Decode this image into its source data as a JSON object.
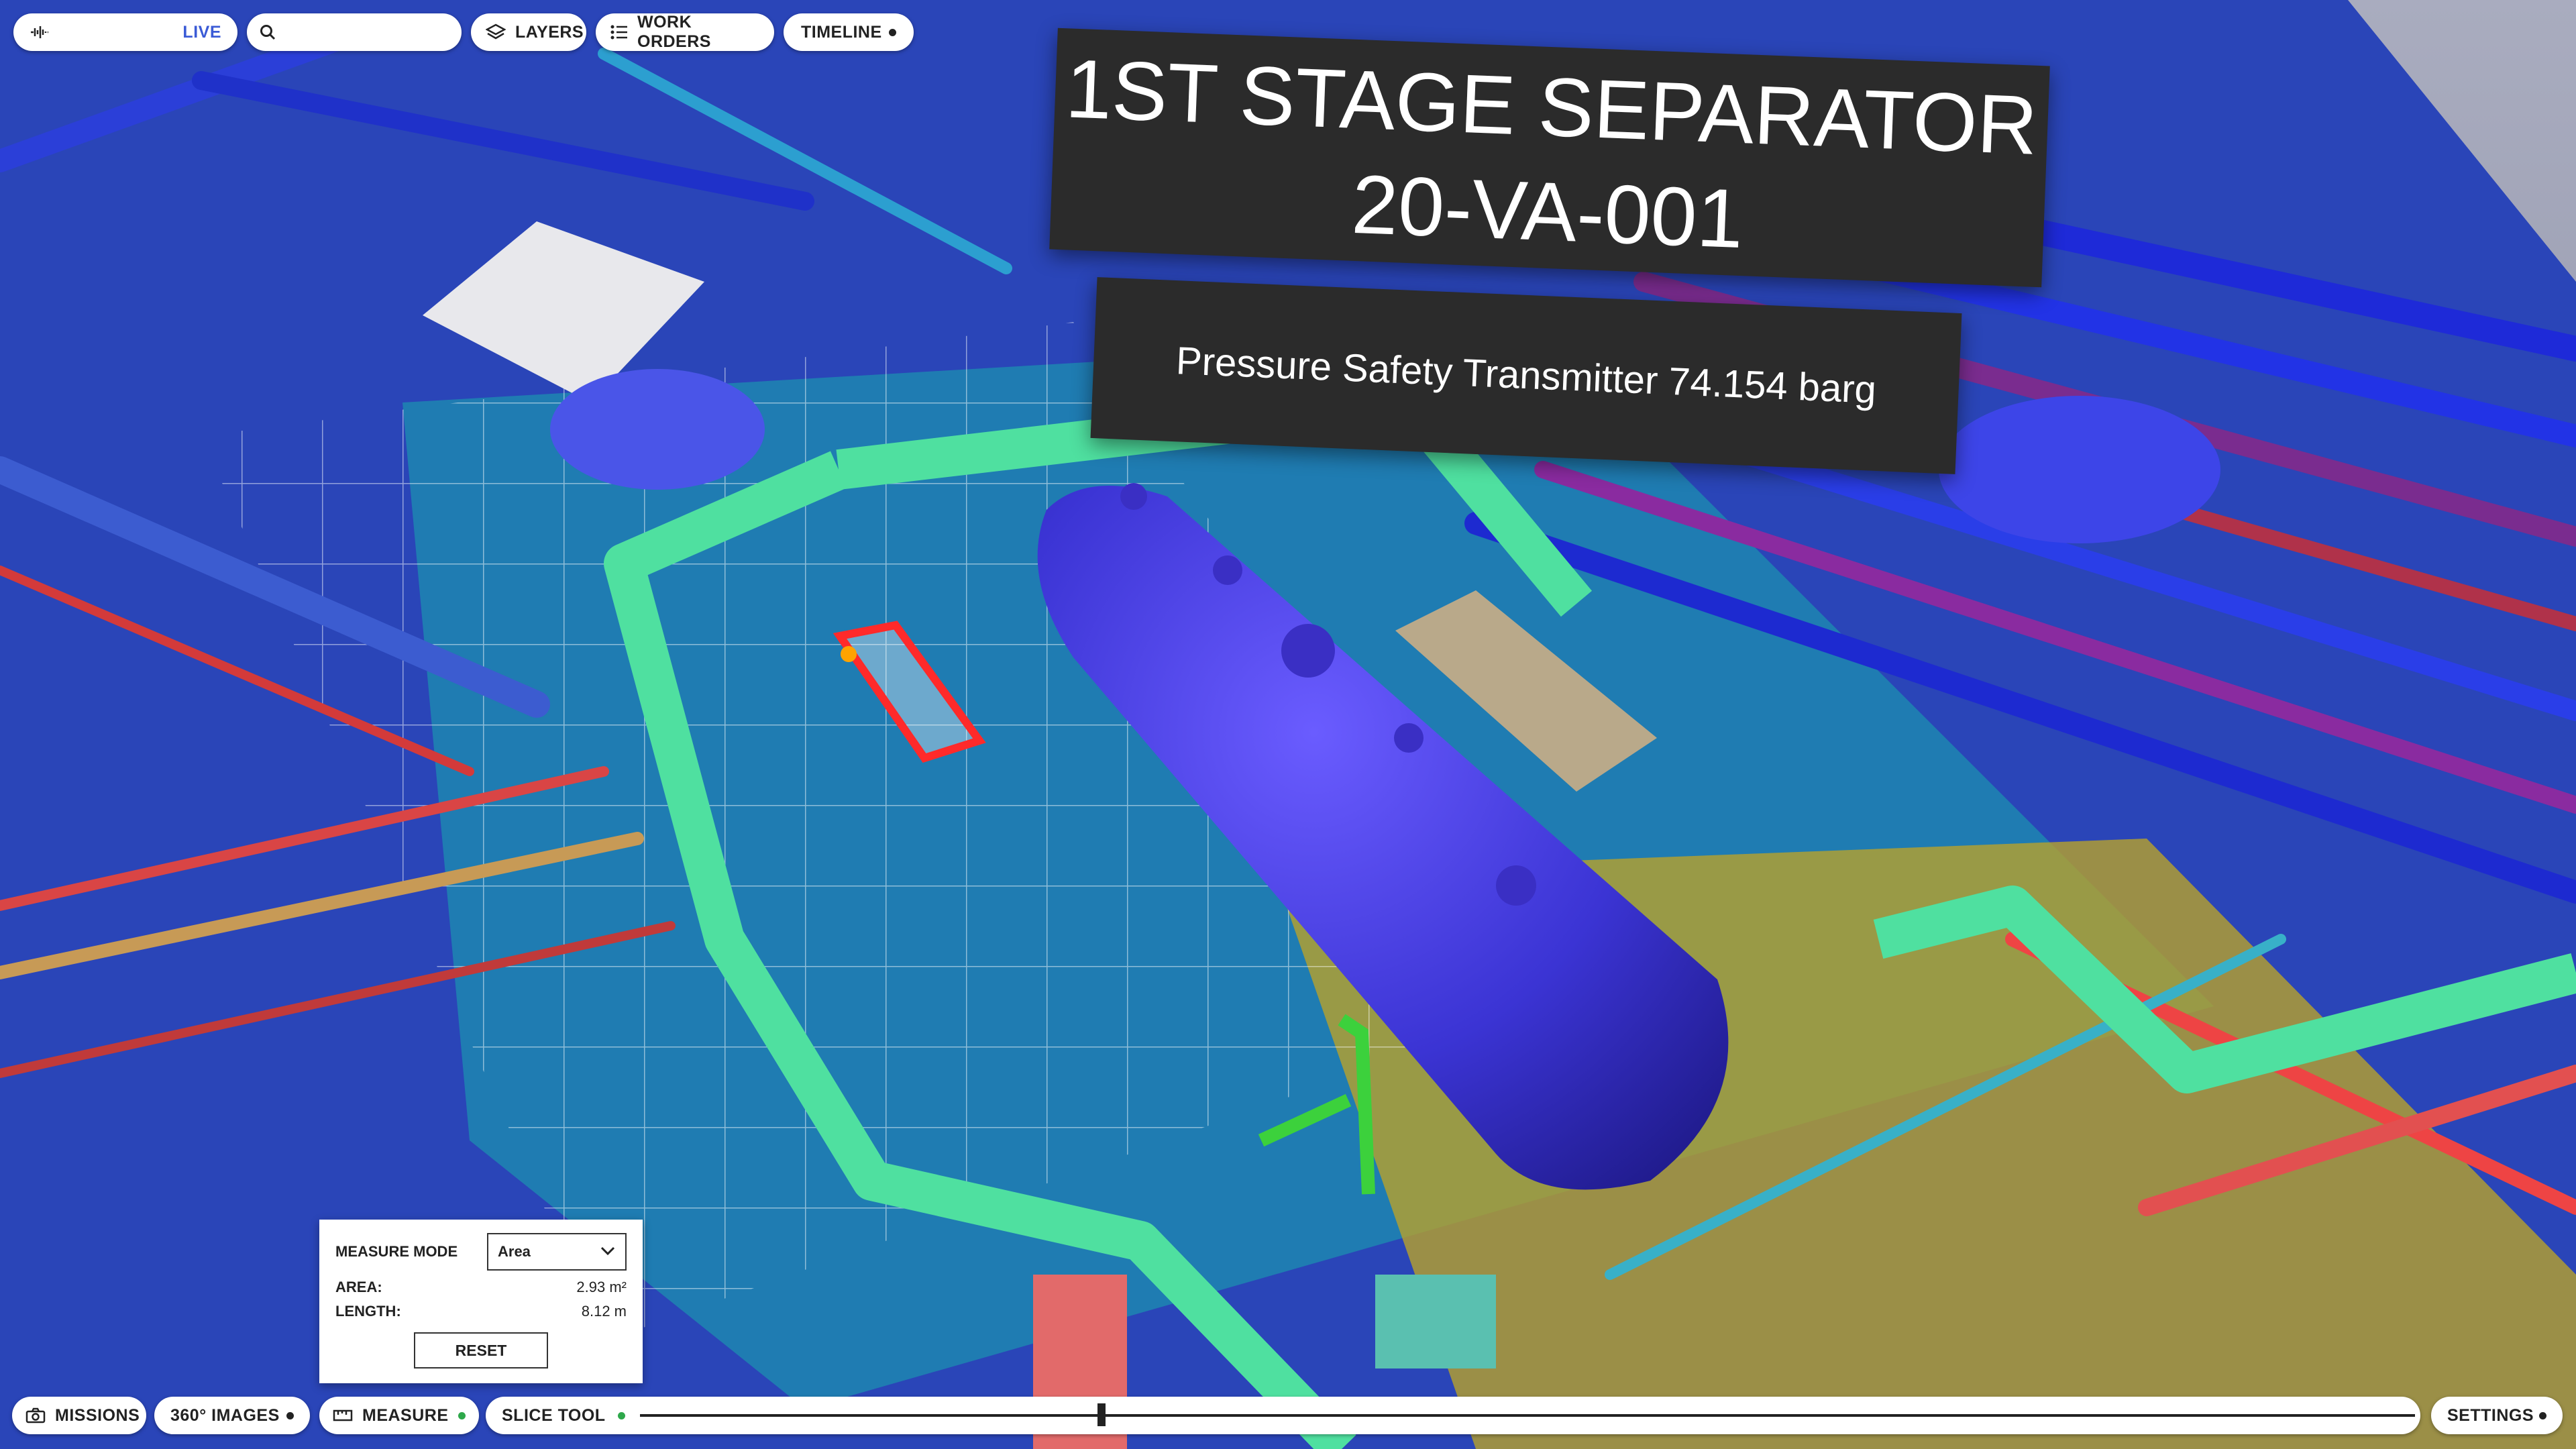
{
  "toolbar": {
    "live_label": "LIVE",
    "search_placeholder": "",
    "layers_label": "LAYERS",
    "work_orders_label": "WORK ORDERS",
    "timeline_label": "TIMELINE"
  },
  "equipment": {
    "title_line1": "1ST STAGE SEPARATOR",
    "title_line2": "20-VA-001",
    "reading": "Pressure Safety Transmitter 74.154 barg"
  },
  "measure_panel": {
    "mode_label": "MEASURE MODE",
    "mode_value": "Area",
    "area_label": "AREA:",
    "area_value": "2.93 m²",
    "length_label": "LENGTH:",
    "length_value": "8.12 m",
    "reset_label": "RESET"
  },
  "bottom_bar": {
    "missions_label": "MISSIONS",
    "images_label": "360° IMAGES",
    "measure_label": "MEASURE",
    "slice_tool_label": "SLICE TOOL",
    "settings_label": "SETTINGS",
    "slice_position": 0.26
  },
  "colors": {
    "toolbar_bg": "#ffffff",
    "banner_bg": "#2b2b2b",
    "live_accent": "#3b5bd6",
    "active_dot": "#2ea84b",
    "vessel": "#4a3fe0",
    "walkway": "#4fe0a0",
    "selection": "#ff2a2a"
  }
}
